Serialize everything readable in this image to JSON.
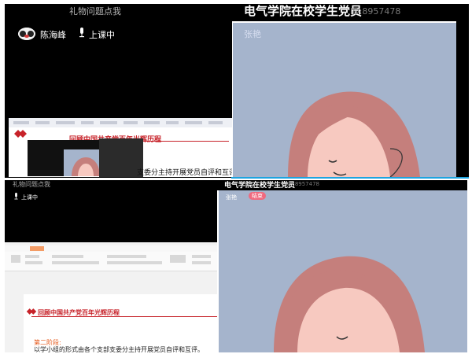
{
  "top": {
    "header_left": "礼物问题点我",
    "room_title": "电气学院在校学生党员",
    "room_id": "ID:8957478",
    "username": "陈海峰",
    "status": "上课中",
    "right_name": "张艳",
    "share": {
      "banner": "回顾中国共产党百年光辉历程",
      "text": "支委分主持开展党员自评和互评。"
    }
  },
  "bottom": {
    "header_left": "礼物问题点我",
    "room_title": "电气学院在校学生党员",
    "room_id": "ID:8957478",
    "status": "上课中",
    "right_name": "张艳",
    "end_label": "结束",
    "doc": {
      "banner": "回顾中国共产党百年光辉历程",
      "section": "第二阶段:",
      "body": "以学小组的形式由各个支部支委分主持开展党员自评和互评。"
    }
  },
  "colors": {
    "video_bg": "#a5b4cc",
    "accent_red": "#c72229",
    "end_button": "#f06a7f",
    "divider_blue": "#1da4e0"
  }
}
